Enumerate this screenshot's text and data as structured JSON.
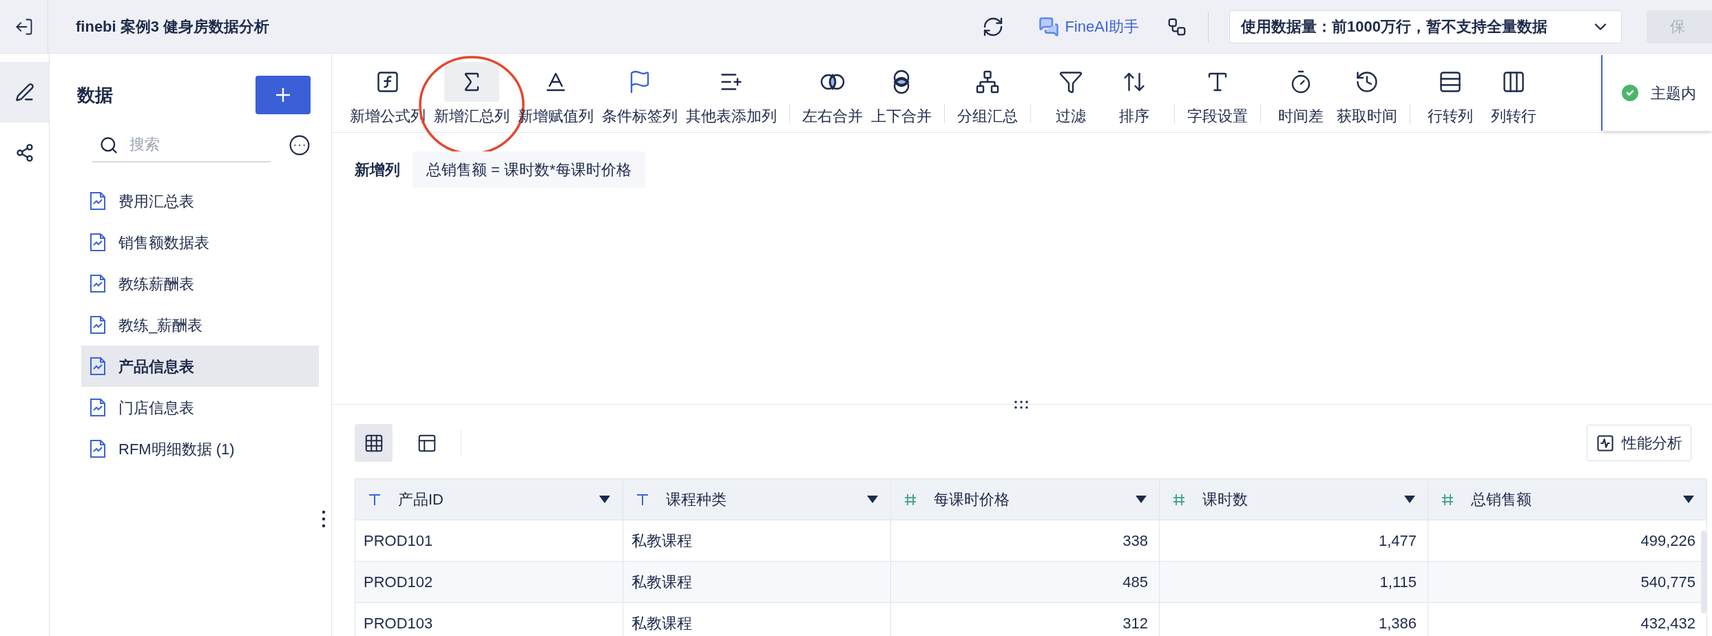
{
  "header": {
    "title": "finebi 案例3 健身房数据分析",
    "ai_label": "FineAI助手",
    "data_scope": "使用数据量：前1000万行，暂不支持全量数据",
    "save_label": "保"
  },
  "rail": [
    {
      "kind": "edit",
      "selected": true
    },
    {
      "kind": "relation",
      "selected": false
    }
  ],
  "sidebar": {
    "title": "数据",
    "search": {
      "placeholder": "搜索"
    },
    "items": [
      {
        "label": "费用汇总表",
        "selected": false
      },
      {
        "label": "销售额数据表",
        "selected": false
      },
      {
        "label": "教练薪酬表",
        "selected": false
      },
      {
        "label": "教练_薪酬表",
        "selected": false
      },
      {
        "label": "产品信息表",
        "selected": true
      },
      {
        "label": "门店信息表",
        "selected": false
      },
      {
        "label": "RFM明细数据 (1)",
        "selected": false
      }
    ]
  },
  "toolbar": {
    "groups": [
      [
        {
          "kind": "formula",
          "label": "新增公式列",
          "selected": false,
          "circled": false
        },
        {
          "kind": "sum",
          "label": "新增汇总列",
          "selected": true,
          "circled": true
        },
        {
          "kind": "assign",
          "label": "新增赋值列",
          "selected": false,
          "circled": false
        },
        {
          "kind": "tag",
          "label": "条件标签列",
          "selected": false,
          "circled": false
        },
        {
          "kind": "append",
          "label": "其他表添加列",
          "selected": false,
          "circled": false
        }
      ],
      [
        {
          "kind": "join-h",
          "label": "左右合并",
          "selected": false,
          "circled": false
        },
        {
          "kind": "join-v",
          "label": "上下合并",
          "selected": false,
          "circled": false
        }
      ],
      [
        {
          "kind": "group",
          "label": "分组汇总",
          "selected": false,
          "circled": false
        }
      ],
      [
        {
          "kind": "filter",
          "label": "过滤",
          "selected": false,
          "circled": false
        },
        {
          "kind": "sort",
          "label": "排序",
          "selected": false,
          "circled": false
        }
      ],
      [
        {
          "kind": "field",
          "label": "字段设置",
          "selected": false,
          "circled": false
        }
      ],
      [
        {
          "kind": "timediff",
          "label": "时间差",
          "selected": false,
          "circled": false
        },
        {
          "kind": "gettime",
          "label": "获取时间",
          "selected": false,
          "circled": false
        }
      ],
      [
        {
          "kind": "row2col",
          "label": "行转列",
          "selected": false,
          "circled": false
        },
        {
          "kind": "col2row",
          "label": "列转行",
          "selected": false,
          "circled": false
        }
      ]
    ]
  },
  "toast": {
    "text": "主题内"
  },
  "formula": {
    "label": "新增列",
    "expression": "总销售额 = 课时数*每课时价格"
  },
  "views": [
    {
      "kind": "grid",
      "selected": true
    },
    {
      "kind": "layout",
      "selected": false
    }
  ],
  "perf_button": "性能分析",
  "table": {
    "columns": [
      {
        "name": "产品ID",
        "kind": "text"
      },
      {
        "name": "课程种类",
        "kind": "text"
      },
      {
        "name": "每课时价格",
        "kind": "number"
      },
      {
        "name": "课时数",
        "kind": "number"
      },
      {
        "name": "总销售额",
        "kind": "number"
      }
    ],
    "rows": [
      [
        "PROD101",
        "私教课程",
        "338",
        "1,477",
        "499,226"
      ],
      [
        "PROD102",
        "私教课程",
        "485",
        "1,115",
        "540,775"
      ],
      [
        "PROD103",
        "私教课程",
        "312",
        "1,386",
        "432,432"
      ]
    ]
  }
}
